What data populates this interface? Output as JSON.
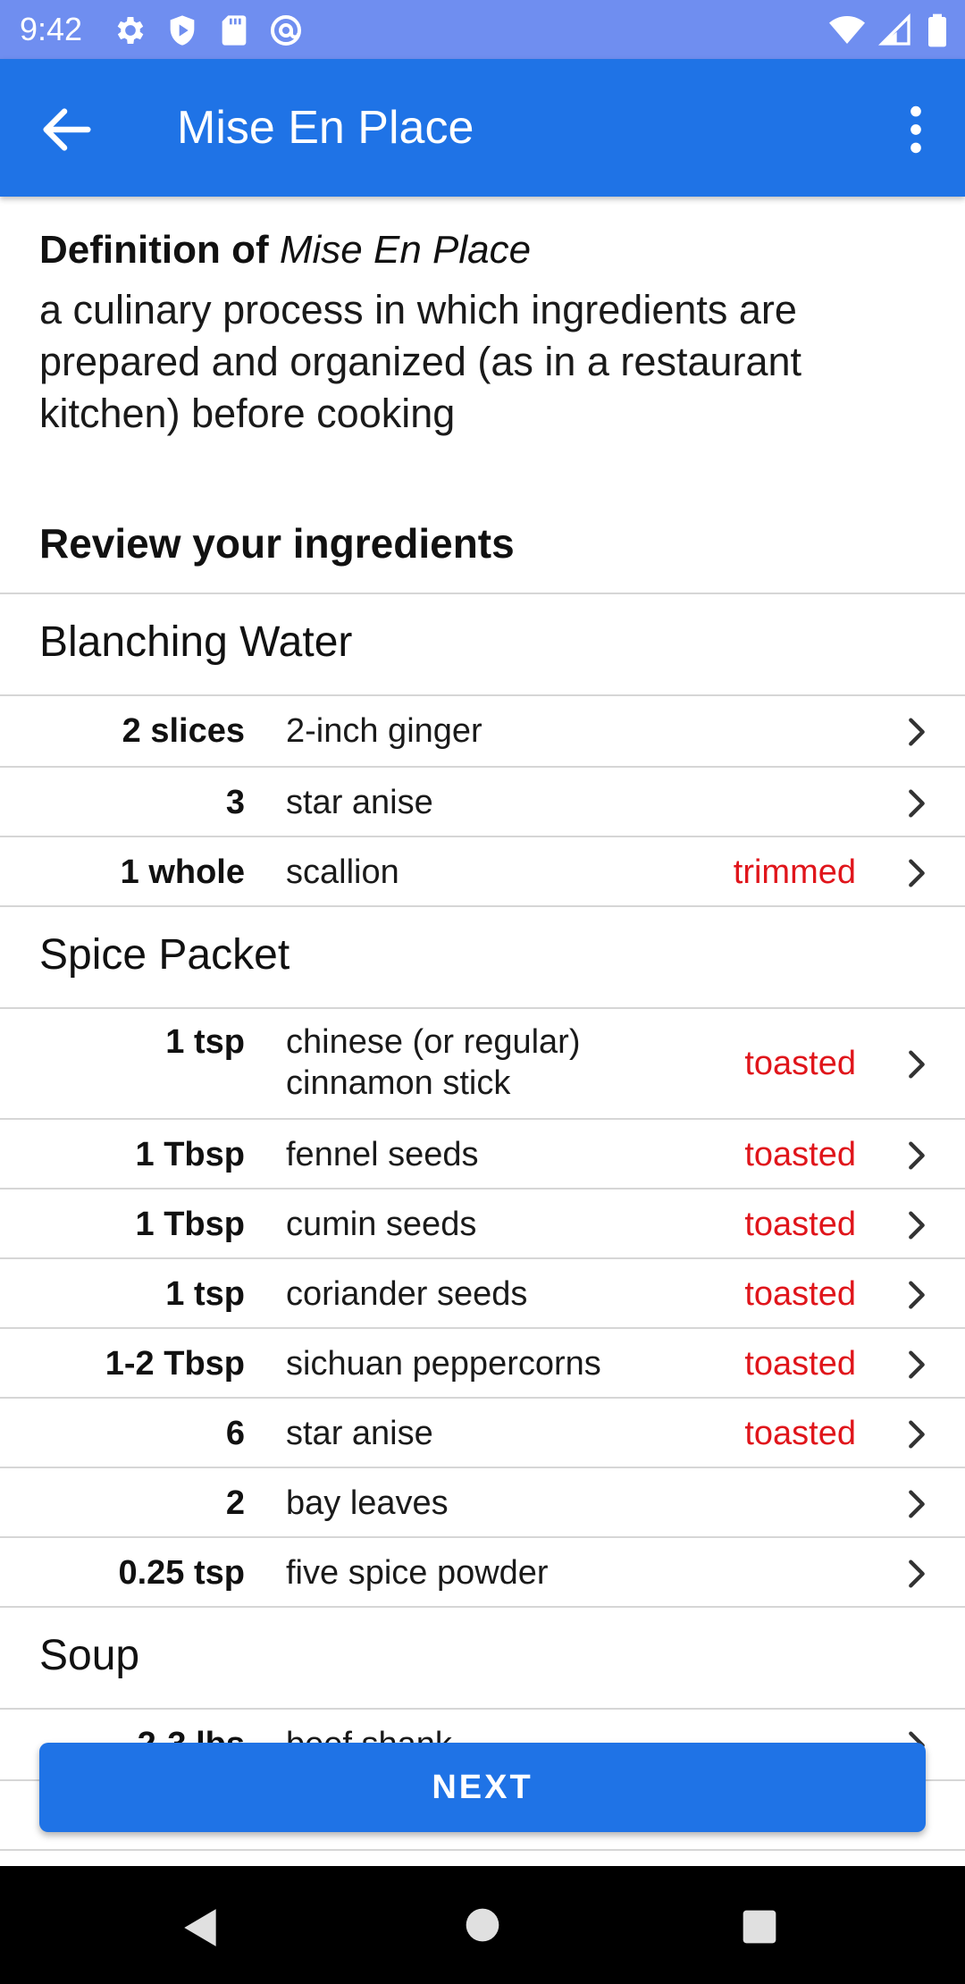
{
  "status_bar": {
    "time": "9:42",
    "icons_left": [
      "gear-icon",
      "shield-icon",
      "sd-card-icon",
      "at-sign-icon"
    ],
    "icons_right": [
      "wifi-icon",
      "signal-icon",
      "battery-icon"
    ]
  },
  "app_bar": {
    "title": "Mise En Place",
    "back_icon": "arrow-left-icon",
    "more_icon": "more-vertical-icon"
  },
  "definition": {
    "prefix": "Definition of ",
    "term": "Mise En Place",
    "text": "a culinary process in which ingredients are prepared and organized (as in a restaurant kitchen) before cooking"
  },
  "review_title": "Review your ingredients",
  "sections": [
    {
      "label": "Blanching Water",
      "items": [
        {
          "qty": "2 slices",
          "name": "2-inch ginger",
          "prep": ""
        },
        {
          "qty": "3",
          "name": "star anise",
          "prep": ""
        },
        {
          "qty": "1 whole",
          "name": "scallion",
          "prep": "trimmed"
        }
      ]
    },
    {
      "label": "Spice Packet",
      "items": [
        {
          "qty": "1 tsp",
          "name": "chinese (or regular) cinnamon stick",
          "prep": "toasted"
        },
        {
          "qty": "1 Tbsp",
          "name": "fennel seeds",
          "prep": "toasted"
        },
        {
          "qty": "1 Tbsp",
          "name": "cumin seeds",
          "prep": "toasted"
        },
        {
          "qty": "1 tsp",
          "name": "coriander seeds",
          "prep": "toasted"
        },
        {
          "qty": "1-2 Tbsp",
          "name": "sichuan peppercorns",
          "prep": "toasted"
        },
        {
          "qty": "6",
          "name": "star anise",
          "prep": "toasted"
        },
        {
          "qty": "2",
          "name": "bay leaves",
          "prep": ""
        },
        {
          "qty": "0.25 tsp",
          "name": "five spice powder",
          "prep": ""
        }
      ]
    },
    {
      "label": "Soup",
      "items": [
        {
          "qty": "2-3 lbs",
          "name": "beef shank",
          "prep": ""
        }
      ]
    }
  ],
  "next_button": "NEXT",
  "colors": {
    "app_bar": "#1f73e6",
    "status_bar": "#6f8ef0",
    "prep_text": "#e0151b"
  }
}
